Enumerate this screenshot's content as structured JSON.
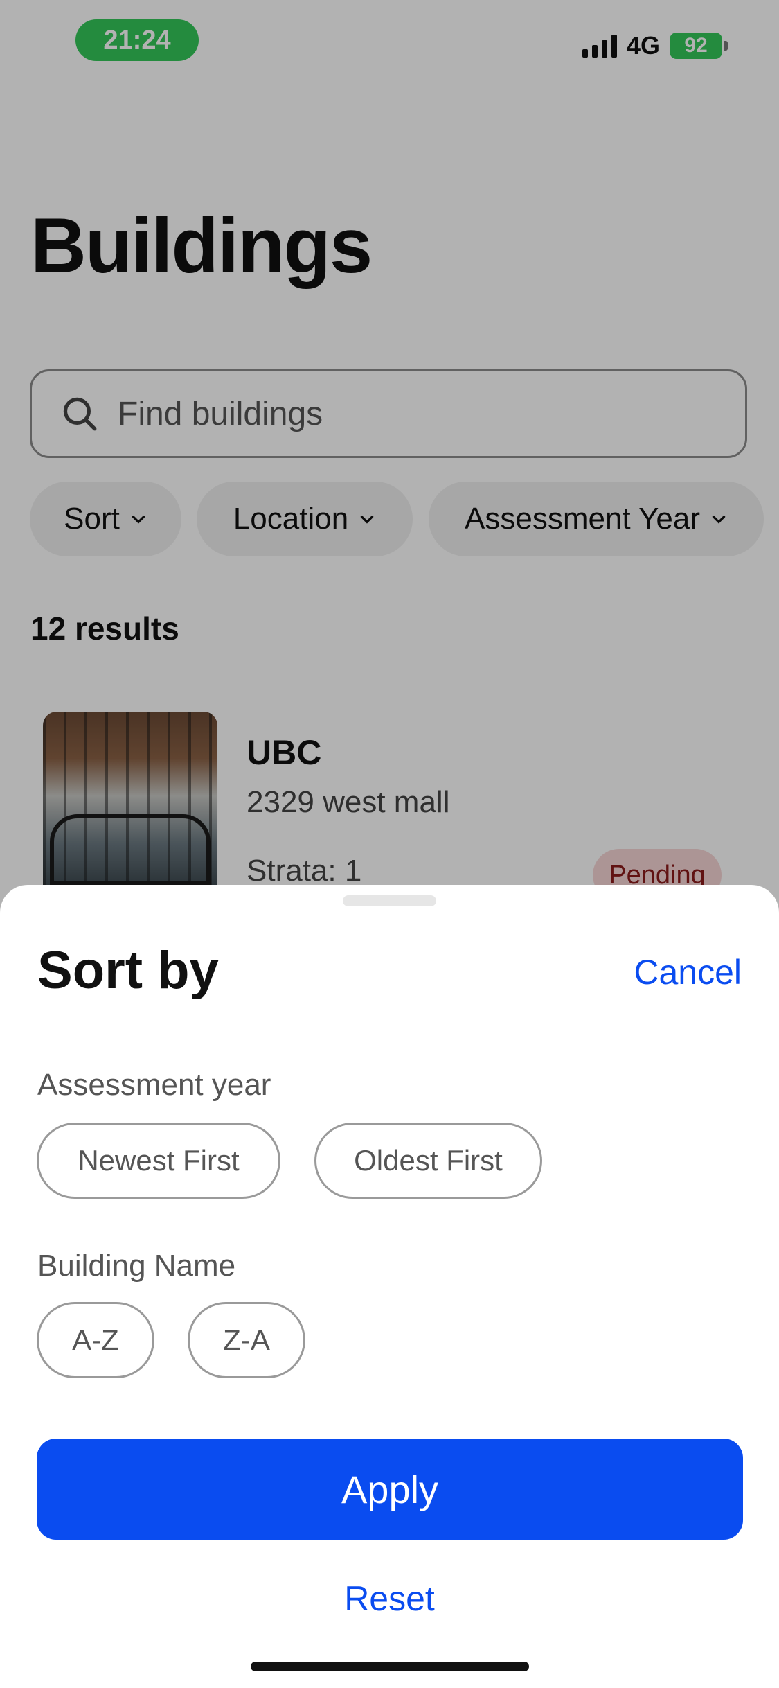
{
  "status": {
    "time": "21:24",
    "network": "4G",
    "battery": "92"
  },
  "page": {
    "title": "Buildings"
  },
  "search": {
    "placeholder": "Find buildings"
  },
  "filters": [
    {
      "label": "Sort"
    },
    {
      "label": "Location"
    },
    {
      "label": "Assessment Year"
    }
  ],
  "results": {
    "count": "12 results"
  },
  "card": {
    "title": "UBC",
    "address": "2329 west mall",
    "strata": "Strata: 1",
    "status": "Pending"
  },
  "sheet": {
    "title": "Sort by",
    "cancel": "Cancel",
    "assessment_label": "Assessment year",
    "newest": "Newest First",
    "oldest": "Oldest First",
    "name_label": "Building Name",
    "az": "A-Z",
    "za": "Z-A",
    "apply": "Apply",
    "reset": "Reset"
  },
  "colors": {
    "accent": "#0a4cf0",
    "status_green": "#34c759",
    "pending_bg": "#f6d6d6",
    "pending_text": "#8b1a1a"
  }
}
